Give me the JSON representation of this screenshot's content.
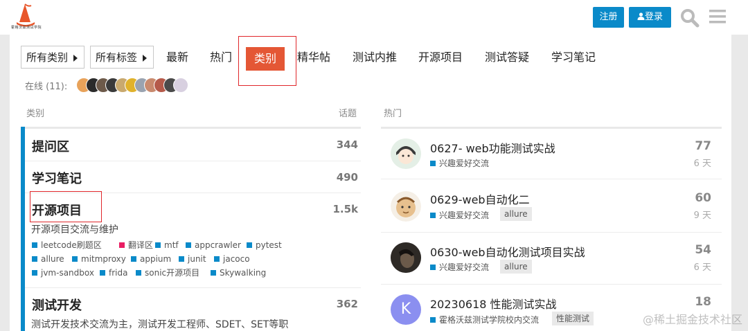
{
  "header": {
    "logo_text": "霍格沃兹测试学院",
    "register_label": "注册",
    "login_label": "登录",
    "accent": "#0a8ac9"
  },
  "nav": {
    "dropdown_categories": "所有类别",
    "dropdown_tags": "所有标签",
    "items": [
      "最新",
      "热门",
      "类别",
      "精华帖",
      "测试内推",
      "开源项目",
      "测试答疑",
      "学习笔记"
    ],
    "active": "类别",
    "active_color": "#e45735"
  },
  "online": {
    "label": "在线 (11):"
  },
  "categories": {
    "header_label": "类别",
    "topics_label": "话题",
    "items": [
      {
        "title": "提问区",
        "count": "344"
      },
      {
        "title": "学习笔记",
        "count": "490"
      },
      {
        "title": "开源项目",
        "count": "1.5k",
        "desc": "开源项目交流与维护",
        "subs": [
          "leetcode刷题区",
          "翻译区",
          "mtf",
          "appcrawler",
          "pytest",
          "allure",
          "mitmproxy",
          "appium",
          "junit",
          "jacoco",
          "jvm-sandbox",
          "frida",
          "sonic开源项目",
          "Skywalking"
        ]
      },
      {
        "title": "测试开发",
        "count": "362",
        "desc": "测试开发技术交流为主，测试开发工程师、SDET、SET等职"
      }
    ]
  },
  "hot": {
    "header_label": "热门",
    "topics": [
      {
        "title": "0627- web功能测试实战",
        "category": "兴趣爱好交流",
        "tag": "",
        "count": "77",
        "age": "6 天"
      },
      {
        "title": "0629-web自动化二",
        "category": "兴趣爱好交流",
        "tag": "allure",
        "count": "60",
        "age": "9 天"
      },
      {
        "title": "0630-web自动化测试项目实战",
        "category": "兴趣爱好交流",
        "tag": "allure",
        "count": "54",
        "age": "6 天"
      },
      {
        "title": "20230618 性能测试实战",
        "category": "霍格沃兹测试学院校内交流",
        "tag": "性能测试",
        "count": "18",
        "age": "",
        "avatar_letter": "K"
      }
    ]
  },
  "watermark": "@稀土掘金技术社区"
}
